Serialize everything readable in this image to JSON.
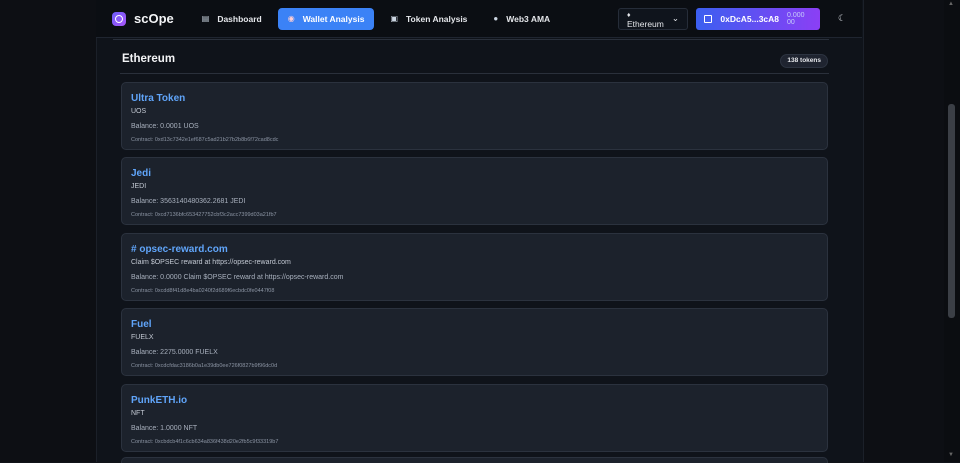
{
  "brand": {
    "name": "scOpe",
    "logo_icon": "scope-logo-icon"
  },
  "nav": {
    "tabs": [
      {
        "label": "Dashboard",
        "icon": "chart-icon",
        "glyph": "▤",
        "active": false
      },
      {
        "label": "Wallet Analysis",
        "icon": "wallet-icon",
        "glyph": "◉",
        "active": true
      },
      {
        "label": "Token Analysis",
        "icon": "token-icon",
        "glyph": "▣",
        "active": false
      },
      {
        "label": "Web3 AMA",
        "icon": "chat-icon",
        "glyph": "●",
        "active": false
      }
    ],
    "network": {
      "label": "Ethereum",
      "dot": "♦",
      "chevron": "⌄"
    },
    "wallet": {
      "address": "0xDcA5...3cA8",
      "balance": "0.000 00"
    },
    "theme_icon": "☾"
  },
  "section": {
    "title": "Ethereum",
    "count": "138 tokens"
  },
  "tokens": [
    {
      "name": "Ultra Token",
      "symbol": "UOS",
      "balance": "Balance: 0.0001 UOS",
      "contract": "Contract: 0xd13c7342e1ef687c5ad21b27b2b8b6f72cad8cdc"
    },
    {
      "name": "Jedi",
      "symbol": "JEDI",
      "balance": "Balance: 3563140480362.2681 JEDI",
      "contract": "Contract: 0xcd7136bfc653427752cbf3c2acc7399d03a21fb7"
    },
    {
      "name": "# opsec-reward.com",
      "symbol": "Claim $OPSEC reward at https://opsec-reward.com",
      "balance": "Balance: 0.0000 Claim $OPSEC reward at https://opsec-reward.com",
      "contract": "Contract: 0xcdd8f41d8e4ba0240f2d689f6ecbdc0fe0447f08"
    },
    {
      "name": "Fuel",
      "symbol": "FUELX",
      "balance": "Balance: 2275.0000 FUELX",
      "contract": "Contract: 0xcdcfdac3186b0a1e39db0ee726f0827b9f96dc0d"
    },
    {
      "name": "PunkETH.io",
      "symbol": "NFT",
      "balance": "Balance: 1.0000 NFT",
      "contract": "Contract: 0xcbdcb4f1c6cb634a836f438d20e2fb5c9f33319b7"
    }
  ],
  "colors": {
    "accent": "#3b82f6",
    "token_name": "#60a5fa",
    "wallet_gradient_start": "#3b5ff0",
    "wallet_gradient_end": "#8b3ff5"
  }
}
